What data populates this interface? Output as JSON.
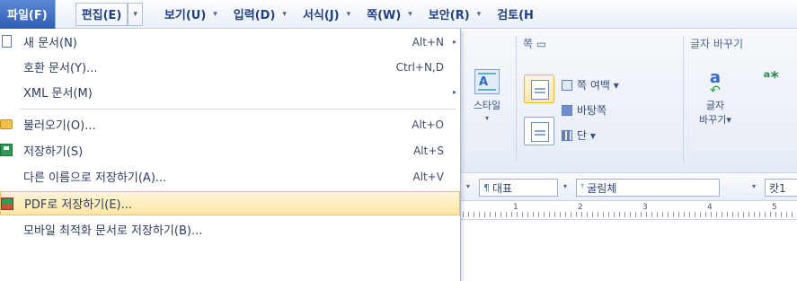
{
  "menubar": {
    "items": [
      {
        "label": "파일(F)",
        "active": true
      },
      {
        "label": "편집(E)"
      },
      {
        "label": "보기(U)"
      },
      {
        "label": "입력(D)"
      },
      {
        "label": "서식(J)"
      },
      {
        "label": "쪽(W)"
      },
      {
        "label": "보안(R)"
      },
      {
        "label": "검토(H"
      }
    ],
    "arrow": "▾"
  },
  "file_menu": {
    "items": [
      {
        "label": "새 문서(N)",
        "shortcut": "Alt+N",
        "submenu": true,
        "icon": "new-document-icon"
      },
      {
        "label": "호환 문서(Y)...",
        "shortcut": "Ctrl+N,D"
      },
      {
        "label": "XML 문서(M)",
        "submenu": true
      },
      {
        "label": "불러오기(O)...",
        "shortcut": "Alt+O",
        "icon": "open-folder-icon"
      },
      {
        "label": "저장하기(S)",
        "shortcut": "Alt+S",
        "icon": "save-icon"
      },
      {
        "label": "다른 이름으로 저장하기(A)...",
        "shortcut": "Alt+V"
      },
      {
        "label": "PDF로 저장하기(E)...",
        "highlighted": true,
        "icon": "pdf-save-icon"
      },
      {
        "label": "모바일 최적화 문서로 저장하기(B)..."
      }
    ],
    "highlight_color": "#ffe6a3"
  },
  "ribbon": {
    "group_page_title": "쪽 ▭",
    "group_convert_title": "글자 바꾸기",
    "style_button": "스타일",
    "page_margin": "쪽 여백 ▾",
    "background": "바탕쪽",
    "columns": "단 ▾",
    "convert_button_line1": "글자",
    "convert_button_line2": "바꾸기▾"
  },
  "format_toolbar": {
    "style_combo": "대표",
    "font_combo": "굴림체",
    "size_combo": "캇1"
  },
  "ruler": {
    "numbers": [
      "1",
      "2",
      "3",
      "4",
      "5"
    ]
  },
  "colors": {
    "menu_active": "#2f5fb5",
    "menu_text": "#22407f"
  }
}
